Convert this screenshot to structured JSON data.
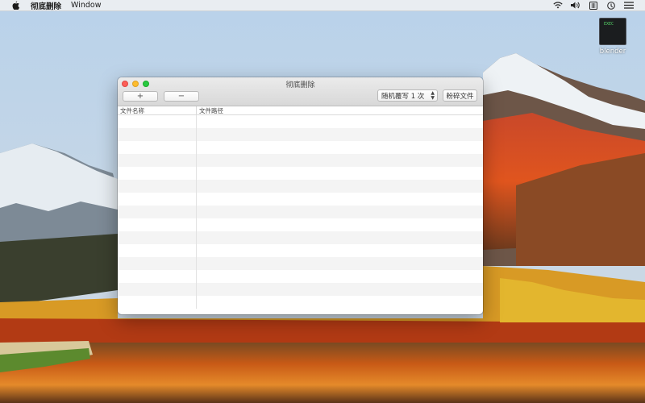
{
  "menubar": {
    "app_name": "彻底删除",
    "menus": [
      "Window"
    ]
  },
  "desktop_icons": [
    {
      "label": "blender",
      "thumb_text": "EXEC"
    }
  ],
  "window": {
    "title": "彻底删除",
    "add_label": "+",
    "remove_label": "−",
    "overwrite_select": {
      "value": "随机覆写 1 次"
    },
    "shred_label": "粉碎文件",
    "table": {
      "columns": [
        "文件名称",
        "文件路径"
      ],
      "rows": []
    }
  },
  "colors": {
    "close": "#fc5f57",
    "minimize": "#fdbc2e",
    "maximize": "#28c941"
  }
}
